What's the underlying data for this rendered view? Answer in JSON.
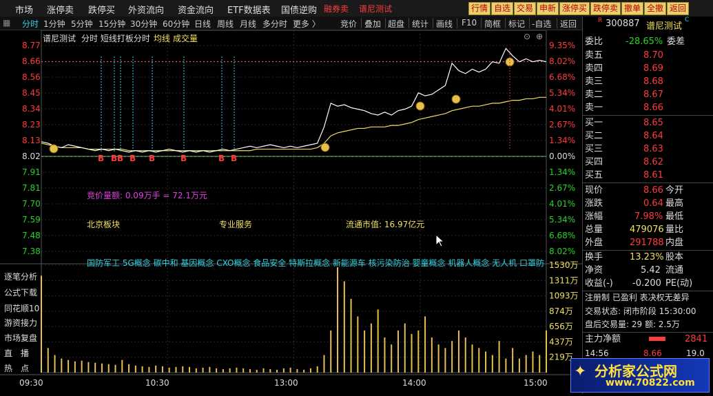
{
  "menu": {
    "items": [
      "市场",
      "涨停卖",
      "跌停买",
      "外资流向",
      "资金流向",
      "ETF数据表",
      "国债逆购"
    ],
    "extra": [
      "融券卖",
      "谱尼测试"
    ],
    "buttons": [
      "行情",
      "自选",
      "交易",
      "申新",
      "涨停买",
      "跌停卖",
      "撤单",
      "全撤",
      "返回"
    ]
  },
  "toolbar": {
    "left": [
      "分时",
      "1分钟",
      "5分钟",
      "15分钟",
      "30分钟",
      "60分钟",
      "日线",
      "周线",
      "月线",
      "多分时",
      "更多 〉"
    ],
    "right": [
      "竞价",
      "叠加",
      "超盘",
      "统计",
      "画线",
      "F10",
      "简框",
      "标记",
      "-自选",
      "返回"
    ]
  },
  "chart_header": {
    "name": "谱尼测试",
    "mode": "分时 短线打板分时",
    "avg_label": "均线",
    "vol_label": "成交量"
  },
  "left_axis": [
    "8.77",
    "8.66",
    "8.56",
    "8.45",
    "8.34",
    "8.23",
    "8.13",
    "8.02",
    "7.91",
    "7.81",
    "7.70",
    "7.59",
    "7.48",
    "7.38"
  ],
  "right_axis": [
    "9.35%",
    "8.02%",
    "6.68%",
    "5.34%",
    "4.01%",
    "2.67%",
    "1.34%",
    "0.00%",
    "1.34%",
    "2.67%",
    "4.01%",
    "5.34%",
    "6.68%",
    "8.02%"
  ],
  "vol_axis": [
    "1530万",
    "1311万",
    "1093万",
    "874万",
    "656万",
    "437万",
    "219万"
  ],
  "time_axis": [
    "09:30",
    "10:30",
    "13:00",
    "14:00",
    "15:00"
  ],
  "annotations": {
    "auction": "竞价量额: 0.09万手 = 72.1万元",
    "board": "北京板块",
    "industry": "专业服务",
    "market_cap": "流通市值: 16.97亿元",
    "concepts": "国防军工 5G概念 碳中和 基因概念 CXO概念 食品安全 特斯拉概念 新能源车 核污染防治 婴童概念 机器人概念 无人机 口罩防"
  },
  "left_panel": [
    "逐笔分析",
    "公式下载",
    "同花顺10",
    "游资接力",
    "市场复盘",
    "直　播",
    "热　点"
  ],
  "stock": {
    "code": "300887",
    "name": "谱尼测试",
    "wb_label": "委比",
    "wb_value": "-28.65%",
    "wc_label": "委差"
  },
  "asks": [
    {
      "label": "卖五",
      "price": "8.70"
    },
    {
      "label": "卖四",
      "price": "8.69"
    },
    {
      "label": "卖三",
      "price": "8.68"
    },
    {
      "label": "卖二",
      "price": "8.67"
    },
    {
      "label": "卖一",
      "price": "8.66"
    }
  ],
  "bids": [
    {
      "label": "买一",
      "price": "8.65"
    },
    {
      "label": "买二",
      "price": "8.64"
    },
    {
      "label": "买三",
      "price": "8.63"
    },
    {
      "label": "买四",
      "price": "8.62"
    },
    {
      "label": "买五",
      "price": "8.61"
    }
  ],
  "quote": {
    "price_label": "现价",
    "price": "8.66",
    "open_label": "今开",
    "chg_label": "涨跌",
    "chg": "0.64",
    "high_label": "最高",
    "pct_label": "涨幅",
    "pct": "7.98%",
    "low_label": "最低",
    "vol_label": "总量",
    "vol": "479076",
    "ratio_label": "量比",
    "out_label": "外盘",
    "out": "291788",
    "in_label": "内盘",
    "turn_label": "换手",
    "turn": "13.23%",
    "cap_label": "股本",
    "nav_label": "净资",
    "nav": "5.42",
    "float_label": "流通",
    "eps_label": "收益(-)",
    "eps": "-0.200",
    "pe_label": "PE(动)"
  },
  "status": {
    "reg": "注册制 已盈利 表决权无差异",
    "trade": "交易状态: 闭市阶段 15:30:00",
    "after": "盘后交易量: 29  额: 2.5万",
    "flow_label": "主力净额",
    "flow": "2841",
    "last_time": "14:56",
    "last_price": "8.66",
    "last_vol": "19.0"
  },
  "watermark": {
    "name": "分析家公式网",
    "url": "www.70822.com"
  },
  "chart_data": {
    "type": "line",
    "prev_close": 8.02,
    "ylim": [
      7.38,
      8.77
    ],
    "price": [
      8.12,
      8.11,
      8.09,
      8.08,
      8.1,
      8.09,
      8.08,
      8.07,
      8.06,
      8.07,
      8.06,
      8.07,
      8.06,
      8.05,
      8.06,
      8.05,
      8.06,
      8.05,
      8.06,
      8.07,
      8.06,
      8.05,
      8.06,
      8.05,
      8.06,
      8.05,
      8.06,
      8.07,
      8.06,
      8.07,
      8.08,
      8.09,
      8.08,
      8.09,
      8.1,
      8.09,
      8.08,
      8.09,
      8.08,
      8.09,
      8.1,
      8.11,
      8.22,
      8.38,
      8.36,
      8.37,
      8.35,
      8.34,
      8.33,
      8.31,
      8.3,
      8.32,
      8.3,
      8.33,
      8.34,
      8.36,
      8.45,
      8.43,
      8.44,
      8.47,
      8.5,
      8.65,
      8.6,
      8.58,
      8.61,
      8.59,
      8.61,
      8.66,
      8.65,
      8.75,
      8.7,
      8.66,
      8.68,
      8.66,
      8.67,
      8.66
    ],
    "avg": [
      8.11,
      8.1,
      8.09,
      8.08,
      8.08,
      8.08,
      8.08,
      8.07,
      8.07,
      8.07,
      8.07,
      8.07,
      8.07,
      8.06,
      8.06,
      8.06,
      8.06,
      8.06,
      8.06,
      8.06,
      8.06,
      8.06,
      8.06,
      8.06,
      8.06,
      8.06,
      8.06,
      8.06,
      8.06,
      8.06,
      8.06,
      8.06,
      8.07,
      8.07,
      8.07,
      8.07,
      8.07,
      8.07,
      8.07,
      8.07,
      8.07,
      8.08,
      8.11,
      8.16,
      8.18,
      8.19,
      8.2,
      8.21,
      8.21,
      8.22,
      8.22,
      8.22,
      8.23,
      8.23,
      8.24,
      8.25,
      8.27,
      8.28,
      8.29,
      8.3,
      8.31,
      8.33,
      8.34,
      8.35,
      8.36,
      8.36,
      8.37,
      8.38,
      8.38,
      8.39,
      8.4,
      8.4,
      8.41,
      8.41,
      8.42,
      8.42
    ],
    "volume": [
      1380,
      350,
      250,
      200,
      180,
      160,
      170,
      150,
      140,
      130,
      120,
      110,
      180,
      120,
      100,
      90,
      80,
      100,
      90,
      70,
      80,
      90,
      80,
      60,
      70,
      80,
      60,
      50,
      60,
      70,
      60,
      50,
      40,
      60,
      50,
      40,
      60,
      70,
      50,
      40,
      60,
      90,
      250,
      600,
      1500,
      1300,
      1050,
      800,
      600,
      700,
      900,
      500,
      400,
      600,
      700,
      550,
      600,
      800,
      500,
      400,
      350,
      450,
      600,
      500,
      400,
      350,
      300,
      250,
      450,
      200,
      350,
      200,
      250,
      300,
      250,
      600
    ]
  },
  "colors": {
    "up": "#ff3b3b",
    "down": "#28d228",
    "price": "#ffffff",
    "avg": "#f0e060",
    "vol": "#e8c050",
    "ask_line": "#30d0e0"
  }
}
